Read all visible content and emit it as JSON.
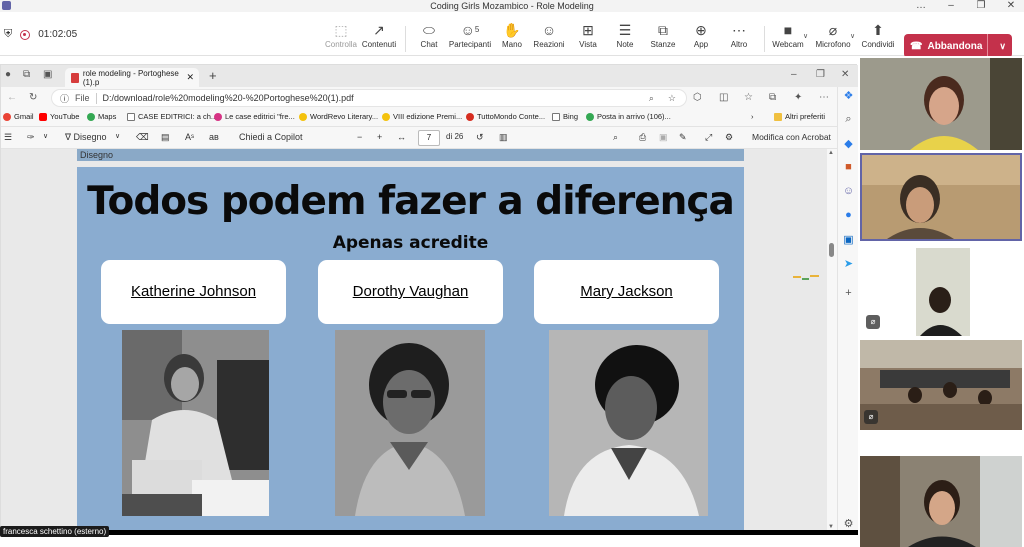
{
  "window": {
    "title": "Coding Girls Mozambico - Role Modeling",
    "controls": [
      "…",
      "–",
      "❐",
      "✕"
    ]
  },
  "meeting": {
    "timer": "01:02:05",
    "toolbar": [
      {
        "label": "Controlla",
        "icon": "control-icon",
        "glyph": "⬚",
        "disabled": true
      },
      {
        "label": "Contenuti",
        "icon": "share-content-icon",
        "glyph": "↗",
        "disabled": false
      },
      {
        "label": "Chat",
        "icon": "chat-icon",
        "glyph": "⬭",
        "disabled": false
      },
      {
        "label": "Partecipanti",
        "icon": "participants-icon",
        "glyph": "☺",
        "disabled": false,
        "count": "5"
      },
      {
        "label": "Mano",
        "icon": "raise-hand-icon",
        "glyph": "✋",
        "disabled": false
      },
      {
        "label": "Reazioni",
        "icon": "reactions-icon",
        "glyph": "☺",
        "disabled": false
      },
      {
        "label": "Vista",
        "icon": "view-icon",
        "glyph": "⊞",
        "disabled": false
      },
      {
        "label": "Note",
        "icon": "notes-icon",
        "glyph": "☰",
        "disabled": false
      },
      {
        "label": "Stanze",
        "icon": "rooms-icon",
        "glyph": "⧉",
        "disabled": false
      },
      {
        "label": "App",
        "icon": "apps-icon",
        "glyph": "⊕",
        "disabled": false
      },
      {
        "label": "Altro",
        "icon": "more-icon",
        "glyph": "⋯",
        "disabled": false
      },
      {
        "label": "Webcam",
        "icon": "camera-icon",
        "glyph": "■",
        "disabled": false
      },
      {
        "label": "Microfono",
        "icon": "microphone-off-icon",
        "glyph": "⌀",
        "disabled": false
      },
      {
        "label": "Condividi",
        "icon": "share-icon",
        "glyph": "⬆",
        "disabled": false
      }
    ],
    "leave_label": "Abbandona",
    "leave_color": "#c4314b"
  },
  "browser": {
    "tab_title": "role modeling - Portoghese (1).p",
    "address_label": "File",
    "url": "D:/download/role%20modeling%20-%20Portoghese%20(1).pdf",
    "bookmarks": [
      {
        "label": "Gmail",
        "icon": "gmail-icon",
        "color": "#ea4335"
      },
      {
        "label": "YouTube",
        "icon": "youtube-icon",
        "color": "#ff0000"
      },
      {
        "label": "Maps",
        "icon": "maps-icon",
        "color": "#34a853"
      },
      {
        "label": "CASE EDITRICI: a ch...",
        "icon": "page-icon",
        "color": "#777777"
      },
      {
        "label": "Le case editrici \"fre...",
        "icon": "site-icon",
        "color": "#d63384"
      },
      {
        "label": "WordRevo Literary...",
        "icon": "site-icon",
        "color": "#f4c20d"
      },
      {
        "label": "VIII edizione Premi...",
        "icon": "site-icon",
        "color": "#f4c20d"
      },
      {
        "label": "TuttoMondo Conte...",
        "icon": "site-icon",
        "color": "#d62d20"
      },
      {
        "label": "Bing",
        "icon": "page-icon",
        "color": "#777777"
      },
      {
        "label": "Posta in arrivo (106)...",
        "icon": "gmail-icon",
        "color": "#34a853"
      }
    ],
    "other_favorites": "Altri preferiti"
  },
  "pdf_toolbar": {
    "draw_label": "Disegno",
    "copilot_label": "Chiedi a Copilot",
    "page_current": "7",
    "page_total": "di 26",
    "acrobat_label": "Modifica con Acrobat"
  },
  "pdf": {
    "prev_page_text": "Disegno",
    "slide_title": "Todos podem fazer a diferença",
    "slide_subtitle": "Apenas acredite",
    "background_color": "#8aacd0",
    "people": [
      {
        "name": "Katherine Johnson"
      },
      {
        "name": "Dorothy Vaughan"
      },
      {
        "name": "Mary Jackson"
      }
    ]
  },
  "participants": {
    "caption": "francesca schettino (esterno)",
    "active_speaker_color": "#6264a7"
  }
}
